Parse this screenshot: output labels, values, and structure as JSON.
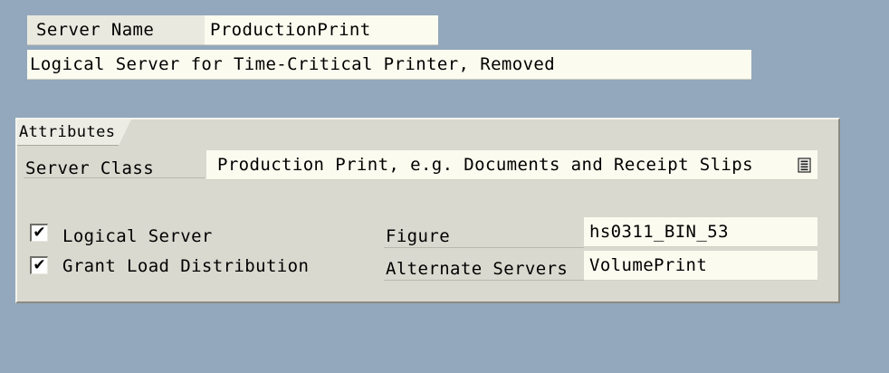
{
  "header": {
    "server_name_label": "Server Name",
    "server_name_value": "ProductionPrint",
    "description_value": "Logical Server for Time-Critical Printer, Removed"
  },
  "attributes": {
    "group_title": "Attributes",
    "server_class_label": "Server Class",
    "server_class_value": "Production Print, e.g. Documents and Receipt Slips",
    "server_class_icon": "dropdown-list-icon",
    "logical_server_label": "Logical Server",
    "logical_server_checked": true,
    "grant_load_label": "Grant Load Distribution",
    "grant_load_checked": true,
    "figure_label": "Figure",
    "figure_value": "hs0311_BIN_53",
    "alternate_servers_label": "Alternate Servers",
    "alternate_servers_value": "VolumePrint"
  },
  "colors": {
    "background": "#93a8bc",
    "group_box": "#d9d9cf",
    "input_field": "#fbfbef",
    "label_block": "#e9e9e0"
  }
}
